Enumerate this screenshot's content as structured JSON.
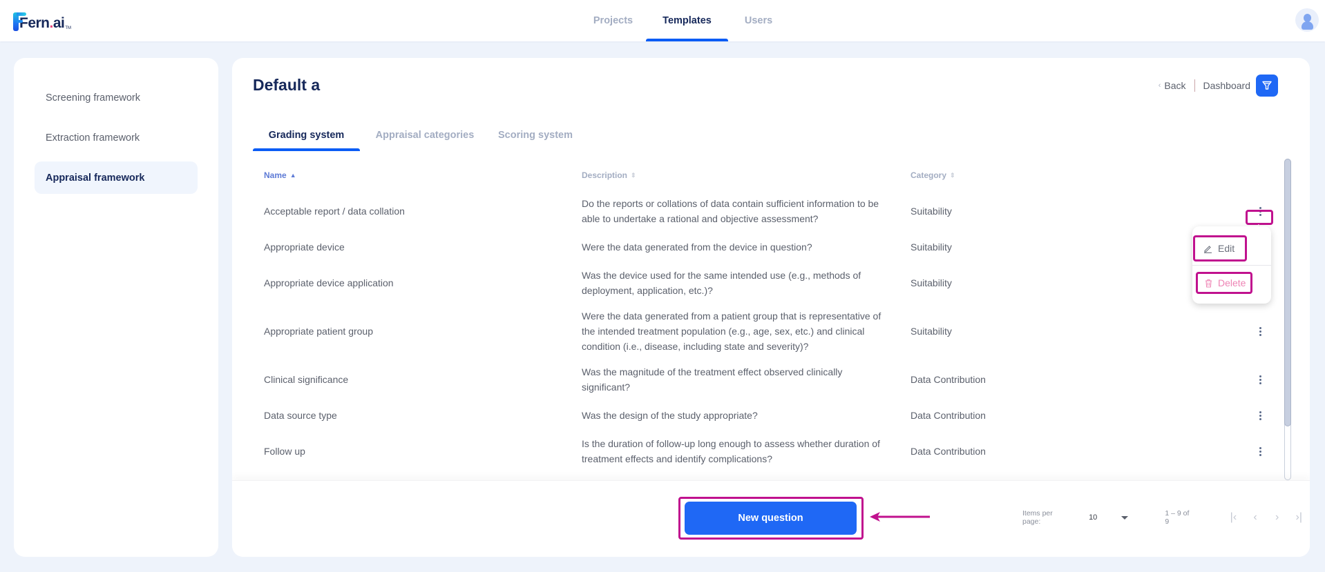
{
  "app": {
    "logo_text": "Fern",
    "logo_dot": ".",
    "logo_suffix": "ai",
    "logo_tm": "TM"
  },
  "nav": {
    "items": [
      {
        "label": "Projects",
        "active": false
      },
      {
        "label": "Templates",
        "active": true
      },
      {
        "label": "Users",
        "active": false
      }
    ]
  },
  "sidebar": {
    "items": [
      {
        "label": "Screening framework",
        "active": false
      },
      {
        "label": "Extraction framework",
        "active": false
      },
      {
        "label": "Appraisal framework",
        "active": true
      }
    ]
  },
  "page": {
    "title": "Default a",
    "back_label": "Back",
    "dashboard_label": "Dashboard",
    "filter_icon": "filter-icon"
  },
  "tabs": [
    {
      "label": "Grading system",
      "active": true
    },
    {
      "label": "Appraisal categories",
      "active": false
    },
    {
      "label": "Scoring system",
      "active": false
    }
  ],
  "table": {
    "columns": [
      {
        "label": "Name",
        "sort": "asc"
      },
      {
        "label": "Description",
        "sort": "none"
      },
      {
        "label": "Category",
        "sort": "none"
      }
    ],
    "rows": [
      {
        "name": "Acceptable report / data collation",
        "description": "Do the reports or collations of data contain sufficient information to be able to undertake a rational and objective assessment?",
        "category": "Suitability"
      },
      {
        "name": "Appropriate device",
        "description": "Were the data generated from the device in question?",
        "category": "Suitability"
      },
      {
        "name": "Appropriate device application",
        "description": "Was the device used for the same intended use (e.g., methods of deployment, application, etc.)?",
        "category": "Suitability"
      },
      {
        "name": "Appropriate patient group",
        "description": "Were the data generated from a patient group that is representative of the intended treatment population (e.g., age, sex, etc.) and clinical condition (i.e., disease, including state and severity)?",
        "category": "Suitability"
      },
      {
        "name": "Clinical significance",
        "description": "Was the magnitude of the treatment effect observed clinically significant?",
        "category": "Data Contribution"
      },
      {
        "name": "Data source type",
        "description": "Was the design of the study appropriate?",
        "category": "Data Contribution"
      },
      {
        "name": "Follow up",
        "description": "Is the duration of follow-up long enough to assess whether duration of treatment effects and identify complications?",
        "category": "Data Contribution"
      }
    ]
  },
  "row_menu": {
    "edit_label": "Edit",
    "delete_label": "Delete"
  },
  "footer": {
    "new_question_label": "New question",
    "items_per_page_label": "Items per page:",
    "items_per_page_value": "10",
    "range_label": "1 – 9 of 9"
  },
  "colors": {
    "accent": "#1f68f5",
    "nav_active": "#0b5cf5",
    "title": "#16285a",
    "highlight": "#c0118e",
    "delete": "#ee84b4"
  }
}
